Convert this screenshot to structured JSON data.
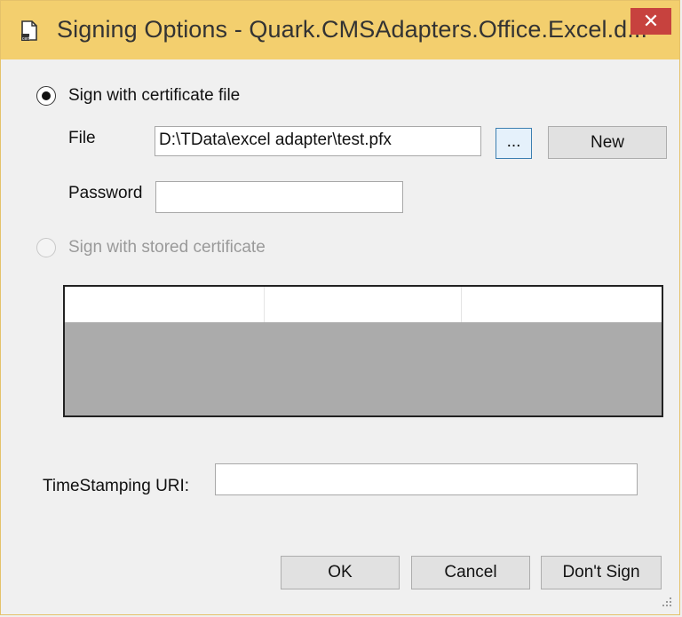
{
  "window": {
    "title": "Signing Options - Quark.CMSAdapters.Office.Excel.d...",
    "close_glyph": "✕",
    "icon": "document-certificate-icon"
  },
  "sign_with_file": {
    "label": "Sign with certificate file",
    "selected": true,
    "file_label": "File",
    "file_value": "D:\\TData\\excel adapter\\test.pfx",
    "browse_label": "...",
    "new_label": "New",
    "password_label": "Password",
    "password_value": ""
  },
  "sign_with_stored": {
    "label": "Sign with stored certificate",
    "selected": false,
    "enabled": false
  },
  "certificate_grid": {
    "columns": [
      "",
      "",
      ""
    ],
    "rows": []
  },
  "timestamping": {
    "label": "TimeStamping URI:",
    "value": ""
  },
  "footer": {
    "ok_label": "OK",
    "cancel_label": "Cancel",
    "dont_sign_label": "Don't Sign"
  },
  "colors": {
    "title_bar": "#f3cf6e",
    "close_button": "#c7423e",
    "grid_body": "#ababab"
  }
}
